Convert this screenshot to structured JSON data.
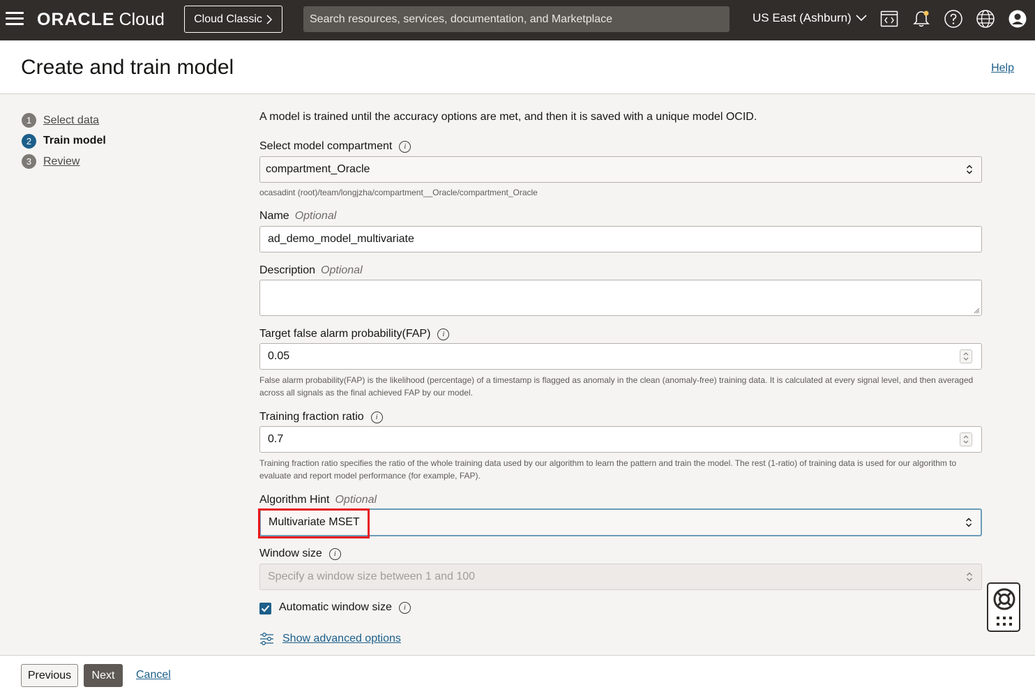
{
  "topbar": {
    "brand": "ORACLE",
    "cloud": "Cloud",
    "classic_button": "Cloud Classic",
    "search_placeholder": "Search resources, services, documentation, and Marketplace",
    "region": "US East (Ashburn)"
  },
  "header": {
    "title": "Create and train model",
    "help": "Help"
  },
  "steps": [
    {
      "num": "1",
      "label": "Select data",
      "active": false
    },
    {
      "num": "2",
      "label": "Train model",
      "active": true
    },
    {
      "num": "3",
      "label": "Review",
      "active": false
    }
  ],
  "form": {
    "intro": "A model is trained until the accuracy options are met, and then it is saved with a unique model OCID.",
    "compartment": {
      "label": "Select model compartment",
      "value": "compartment_Oracle",
      "path": "ocasadint (root)/team/longjzha/compartment__Oracle/compartment_Oracle"
    },
    "name": {
      "label": "Name",
      "optional": "Optional",
      "value": "ad_demo_model_multivariate"
    },
    "description": {
      "label": "Description",
      "optional": "Optional",
      "value": ""
    },
    "fap": {
      "label": "Target false alarm probability(FAP)",
      "value": "0.05",
      "hint": "False alarm probability(FAP) is the likelihood (percentage) of a timestamp is flagged as anomaly in the clean (anomaly-free) training data. It is calculated at every signal level, and then averaged across all signals as the final achieved FAP by our model."
    },
    "training_fraction": {
      "label": "Training fraction ratio",
      "value": "0.7",
      "hint": "Training fraction ratio specifies the ratio of the whole training data used by our algorithm to learn the pattern and train the model. The rest (1-ratio) of training data is used for our algorithm to evaluate and report model performance (for example, FAP)."
    },
    "algorithm": {
      "label": "Algorithm Hint",
      "optional": "Optional",
      "value": "Multivariate MSET"
    },
    "window_size": {
      "label": "Window size",
      "placeholder": "Specify a window size between 1 and 100"
    },
    "auto_window": {
      "label": "Automatic window size",
      "checked": true
    },
    "advanced": "Show advanced options"
  },
  "footer": {
    "previous": "Previous",
    "next": "Next",
    "cancel": "Cancel"
  },
  "colors": {
    "topbar": "#312d2a",
    "accent": "#1c5f8a",
    "highlight": "#e8191d",
    "notification_dot": "#f7c35a"
  }
}
